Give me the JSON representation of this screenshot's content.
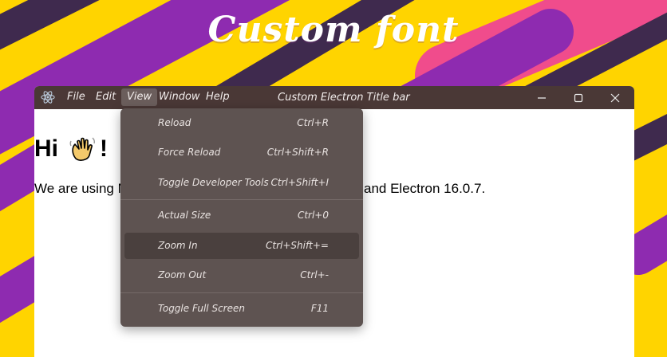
{
  "hero": {
    "title": "Custom font"
  },
  "titlebar": {
    "menus": [
      "File",
      "Edit",
      "View",
      "Window",
      "Help"
    ],
    "active_menu": "View",
    "title": "Custom Electron Title bar",
    "controls": [
      "minimize",
      "maximize",
      "close"
    ]
  },
  "content": {
    "heading_text": "Hi",
    "heading_suffix": "!",
    "heading_emoji": "waving-hand-icon",
    "paragraph_start": "We are using N",
    "paragraph_end": "and Electron 16.0.7."
  },
  "view_menu": {
    "items": [
      {
        "label": "Reload",
        "accelerator": "Ctrl+R"
      },
      {
        "label": "Force Reload",
        "accelerator": "Ctrl+Shift+R"
      },
      {
        "label": "Toggle Developer Tools",
        "accelerator": "Ctrl+Shift+I"
      },
      {
        "label": "Actual Size",
        "accelerator": "Ctrl+0"
      },
      {
        "label": "Zoom In",
        "accelerator": "Ctrl+Shift+="
      },
      {
        "label": "Zoom Out",
        "accelerator": "Ctrl+-"
      },
      {
        "label": "Toggle Full Screen",
        "accelerator": "F11"
      }
    ],
    "highlighted": "Zoom In"
  },
  "colors": {
    "background": "#FFD400",
    "stripe_purple": "#8E2BB0",
    "stripe_pink": "#F04C8C",
    "stripe_dark": "#3F2A4E",
    "titlebar": "#4a3836",
    "menu_bg": "#5e5351"
  }
}
